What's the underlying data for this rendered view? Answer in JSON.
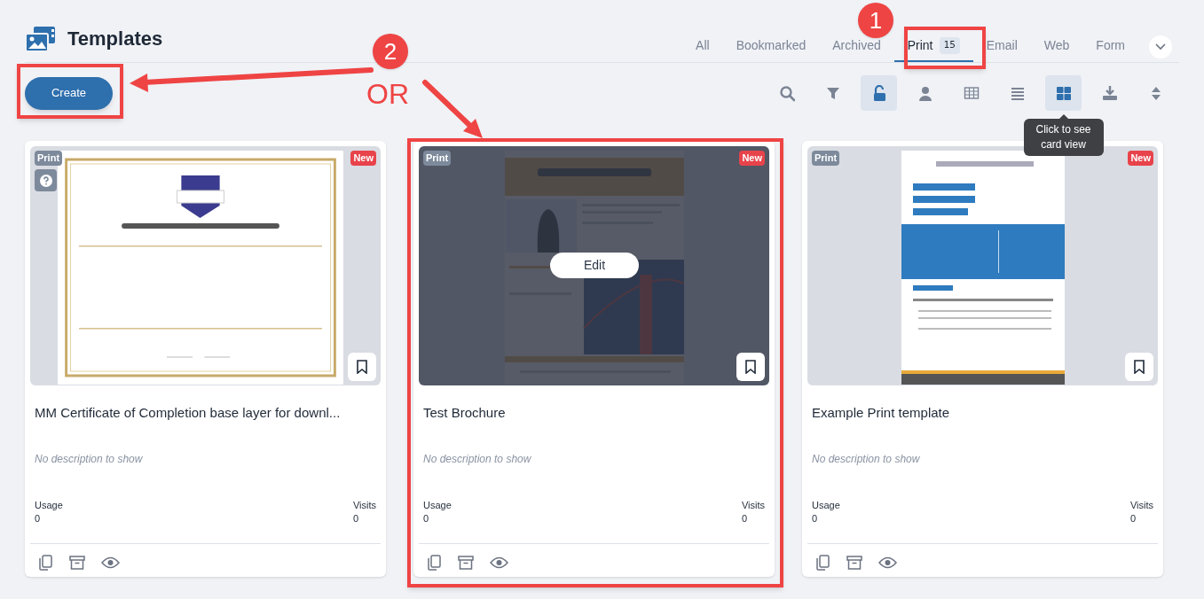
{
  "header": {
    "title": "Templates"
  },
  "tabs": [
    {
      "label": "All",
      "selected": false
    },
    {
      "label": "Bookmarked",
      "selected": false
    },
    {
      "label": "Archived",
      "selected": false
    },
    {
      "label": "Print",
      "selected": true,
      "count": "15"
    },
    {
      "label": "Email",
      "selected": false
    },
    {
      "label": "Web",
      "selected": false
    },
    {
      "label": "Form",
      "selected": false
    }
  ],
  "create_button": "Create",
  "toolbar": [
    {
      "kind": "search",
      "selected": false
    },
    {
      "kind": "filter",
      "selected": false
    },
    {
      "kind": "lock",
      "selected": true
    },
    {
      "kind": "person",
      "selected": false
    },
    {
      "kind": "table",
      "selected": false
    },
    {
      "kind": "list",
      "selected": false
    },
    {
      "kind": "grid",
      "selected": true,
      "tooltip": "Click to see card view"
    },
    {
      "kind": "download",
      "selected": false
    },
    {
      "kind": "sort",
      "selected": false
    }
  ],
  "cards": [
    {
      "type_badge": "Print",
      "new_badge": "New",
      "help": true,
      "hovered": false,
      "title": "MM Certificate of Completion base layer for downl...",
      "description": "No description to show",
      "usage_label": "Usage",
      "usage": "0",
      "visits_label": "Visits",
      "visits": "0"
    },
    {
      "type_badge": "Print",
      "new_badge": "New",
      "help": false,
      "hovered": true,
      "edit_label": "Edit",
      "title": "Test Brochure",
      "description": "No description to show",
      "usage_label": "Usage",
      "usage": "0",
      "visits_label": "Visits",
      "visits": "0"
    },
    {
      "type_badge": "Print",
      "new_badge": "New",
      "help": false,
      "hovered": false,
      "title": "Example Print template",
      "description": "No description to show",
      "usage_label": "Usage",
      "usage": "0",
      "visits_label": "Visits",
      "visits": "0"
    }
  ],
  "annotations": {
    "callouts": [
      "1",
      "2"
    ],
    "or_text": "OR"
  }
}
